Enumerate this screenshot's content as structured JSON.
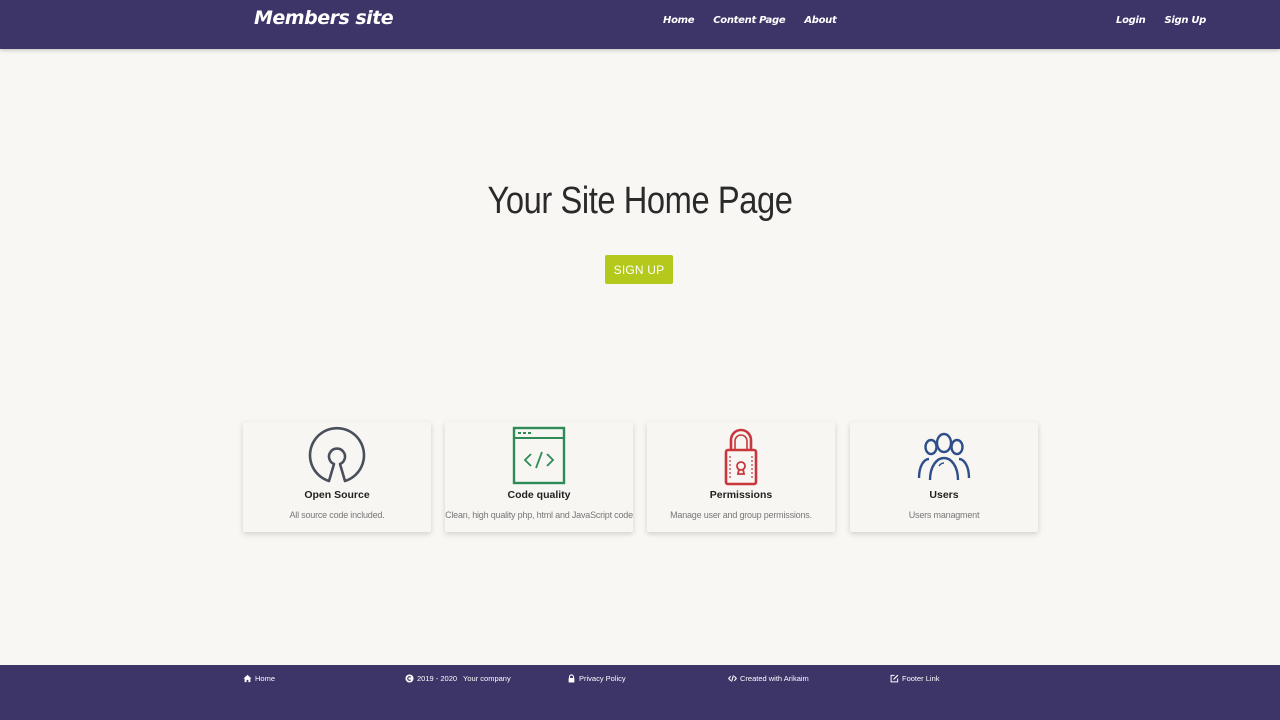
{
  "header": {
    "brand": "Members site",
    "nav": [
      {
        "label": "Home"
      },
      {
        "label": "Content Page"
      },
      {
        "label": "About"
      }
    ],
    "auth": {
      "login": "Login",
      "signup": "Sign Up"
    }
  },
  "hero": {
    "title": "Your Site Home Page",
    "button": "SIGN UP"
  },
  "features": [
    {
      "title": "Open Source",
      "desc": "All source code included.",
      "icon": "open-source-icon",
      "color": "#4a4f5c"
    },
    {
      "title": "Code quality",
      "desc": "Clean, high quality php, html and JavaScript code",
      "icon": "code-window-icon",
      "color": "#2e8b57"
    },
    {
      "title": "Permissions",
      "desc": "Manage user and group permissions.",
      "icon": "lock-icon",
      "color": "#c9363c"
    },
    {
      "title": "Users",
      "desc": "Users managment",
      "icon": "users-icon",
      "color": "#2f4f8a"
    }
  ],
  "footer": {
    "home": "Home",
    "years": "2019 - 2020",
    "company": "Your company",
    "privacy": "Privacy Policy",
    "created": "Created with Arikaim",
    "link": "Footer Link"
  },
  "colors": {
    "navbar": "#3d3468",
    "accent": "#b4c91b",
    "background": "#f8f7f3"
  }
}
